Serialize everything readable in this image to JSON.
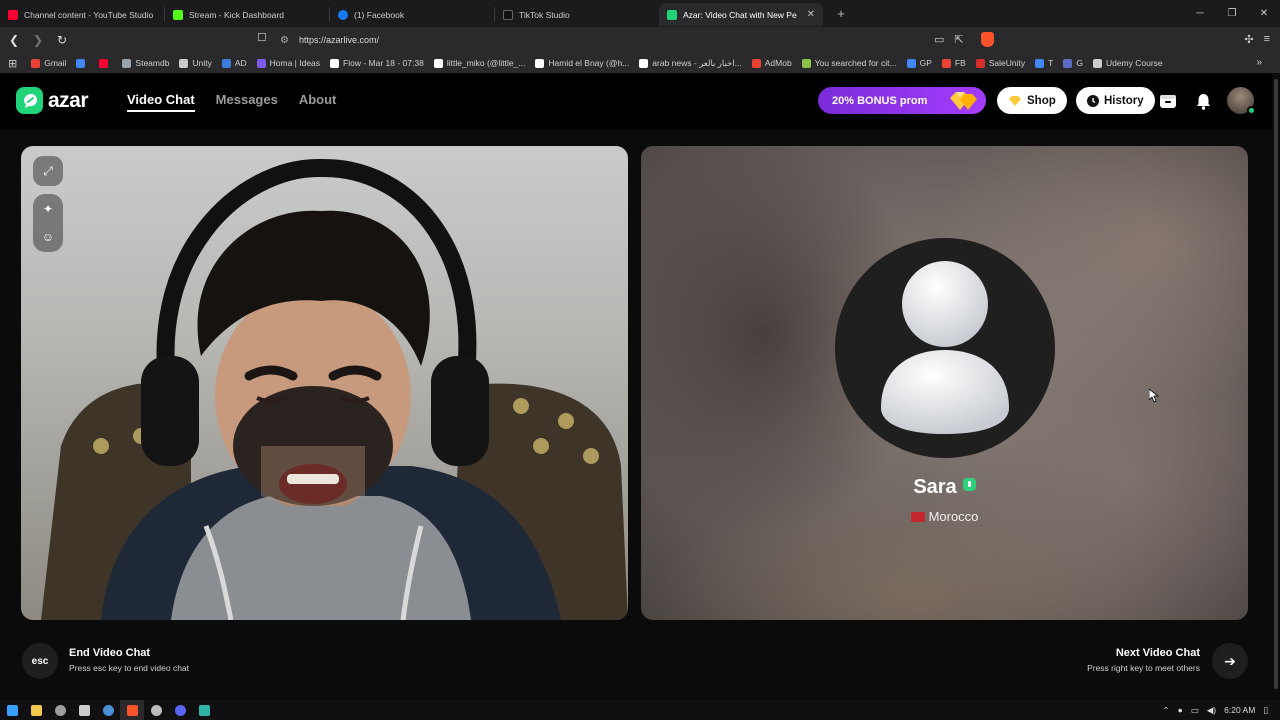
{
  "browser": {
    "tabs": [
      {
        "title": "Channel content - YouTube Studio",
        "color": "#ff0033",
        "active": false
      },
      {
        "title": "Stream - Kick Dashboard",
        "color": "#53fc18",
        "active": false
      },
      {
        "title": "(1) Facebook",
        "color": "#1877f2",
        "active": false
      },
      {
        "title": "TikTok Studio",
        "color": "#ffffff",
        "active": false
      },
      {
        "title": "Azar: Video Chat with New Pe",
        "color": "#21d47a",
        "active": true
      }
    ],
    "url": "https://azarlive.com/",
    "bookmarks": [
      {
        "label": "Gmail",
        "color": "#ea4335"
      },
      {
        "label": "",
        "color": "#4285f4"
      },
      {
        "label": "",
        "color": "#ff0033"
      },
      {
        "label": "Steamdb",
        "color": "#9aa4ad"
      },
      {
        "label": "Unity",
        "color": "#cccccc"
      },
      {
        "label": "AD",
        "color": "#3b7bdb"
      },
      {
        "label": "Homa | Ideas",
        "color": "#7f5af0"
      },
      {
        "label": "Flow - Mar 18 - 07:38",
        "color": "#ffffff"
      },
      {
        "label": "little_miko (@little_...",
        "color": "#ffffff"
      },
      {
        "label": "Hamid el Bnay (@h...",
        "color": "#ffffff"
      },
      {
        "label": "arab news - اخبار بالعر...",
        "color": "#ffffff"
      },
      {
        "label": "AdMob",
        "color": "#ea4335"
      },
      {
        "label": "You searched for cit...",
        "color": "#8bc34a"
      },
      {
        "label": "GP",
        "color": "#4285f4"
      },
      {
        "label": "FB",
        "color": "#ea4335"
      },
      {
        "label": "SaleUnity",
        "color": "#d32f2f"
      },
      {
        "label": "T",
        "color": "#4285f4"
      },
      {
        "label": "G",
        "color": "#5c6bc0"
      },
      {
        "label": "Udemy Course",
        "color": "#cccccc"
      }
    ]
  },
  "azar": {
    "logo_text": "azar",
    "nav": [
      {
        "label": "Video Chat",
        "active": true
      },
      {
        "label": "Messages",
        "active": false
      },
      {
        "label": "About",
        "active": false
      }
    ],
    "promo_label": "20% BONUS prom",
    "shop_label": "Shop",
    "history_label": "History"
  },
  "partner": {
    "name": "Sara",
    "country": "Morocco"
  },
  "controls": {
    "esc_key": "esc",
    "end_title": "End Video Chat",
    "end_sub": "Press esc key to end video chat",
    "next_title": "Next Video Chat",
    "next_sub": "Press right key to meet others"
  },
  "taskbar": {
    "time": "6:20 AM"
  },
  "colors": {
    "accent": "#21d47a",
    "promo": "#a53dff"
  }
}
